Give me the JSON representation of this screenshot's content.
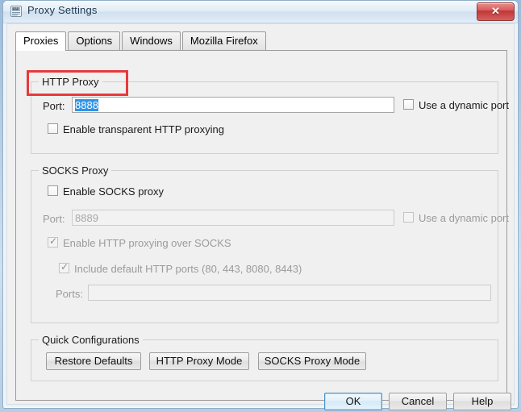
{
  "window": {
    "title": "Proxy Settings",
    "icon": "app-icon",
    "close_label": "✕"
  },
  "tabs": [
    {
      "label": "Proxies",
      "selected": true
    },
    {
      "label": "Options",
      "selected": false
    },
    {
      "label": "Windows",
      "selected": false
    },
    {
      "label": "Mozilla Firefox",
      "selected": false
    }
  ],
  "http_proxy": {
    "group_title": "HTTP Proxy",
    "port_label": "Port:",
    "port_value": "8888",
    "port_selected": true,
    "dynamic_port_label": "Use a dynamic port",
    "dynamic_port_checked": false,
    "transparent_label": "Enable transparent HTTP proxying",
    "transparent_checked": false
  },
  "socks_proxy": {
    "group_title": "SOCKS Proxy",
    "enable_label": "Enable SOCKS proxy",
    "enable_checked": false,
    "port_label": "Port:",
    "port_value": "8889",
    "port_disabled": true,
    "dynamic_port_label": "Use a dynamic port",
    "dynamic_port_checked": false,
    "dynamic_port_disabled": true,
    "http_over_socks_label": "Enable HTTP proxying over SOCKS",
    "http_over_socks_checked": true,
    "http_over_socks_disabled": true,
    "default_ports_label": "Include default HTTP ports (80, 443, 8080, 8443)",
    "default_ports_checked": true,
    "default_ports_disabled": true,
    "ports_label": "Ports:",
    "ports_value": "",
    "ports_disabled": true
  },
  "quick_config": {
    "group_title": "Quick Configurations",
    "buttons": [
      {
        "label": "Restore Defaults"
      },
      {
        "label": "HTTP Proxy Mode"
      },
      {
        "label": "SOCKS Proxy Mode"
      }
    ]
  },
  "dialog_buttons": [
    {
      "label": "OK",
      "default": true
    },
    {
      "label": "Cancel",
      "default": false
    },
    {
      "label": "Help",
      "default": false
    }
  ],
  "annotation": {
    "color": "#e8393c",
    "target": "http-proxy-port-row"
  }
}
